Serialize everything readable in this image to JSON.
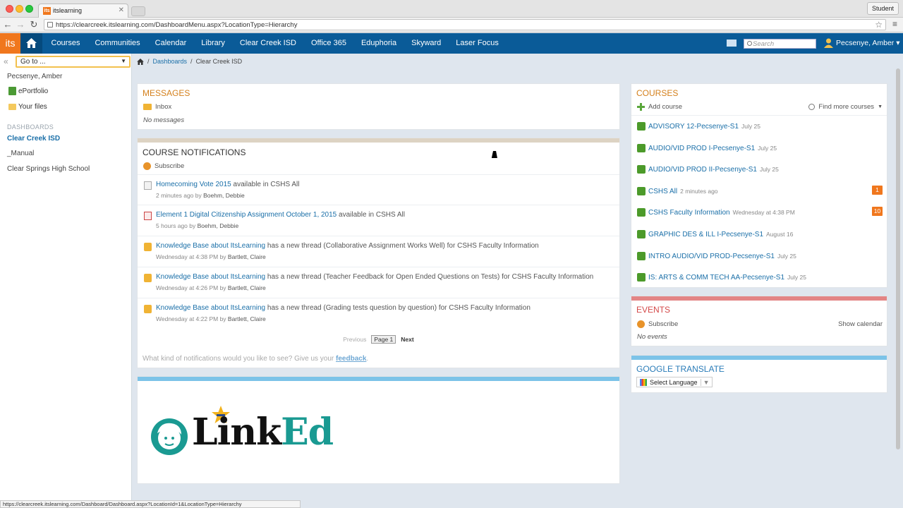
{
  "browser": {
    "tab_title": "itslearning",
    "tab_favicon": "its",
    "profile": "Student",
    "url": "https://clearcreek.itslearning.com/DashboardMenu.aspx?LocationType=Hierarchy",
    "status_url": "https://clearcreek.itslearning.com/Dashboard/Dashboard.aspx?LocationId=1&LocationType=Hierarchy"
  },
  "topbar": {
    "logo": "its",
    "nav": [
      "Courses",
      "Communities",
      "Calendar",
      "Library",
      "Clear Creek ISD",
      "Office 365",
      "Eduphoria",
      "Skyward",
      "Laser Focus"
    ],
    "search_placeholder": "Search",
    "user": "Pecsenye, Amber",
    "accent": "#0a5b98"
  },
  "sidebar": {
    "goto": "Go to ...",
    "user": "Pecsenye, Amber",
    "links": [
      "ePortfolio",
      "Your files"
    ],
    "dashboards_heading": "DASHBOARDS",
    "active": "Clear Creek ISD",
    "items": [
      "_Manual",
      "Clear Springs High School"
    ]
  },
  "breadcrumb": {
    "link": "Dashboards",
    "current": "Clear Creek ISD"
  },
  "messages": {
    "title": "MESSAGES",
    "inbox": "Inbox",
    "empty": "No messages"
  },
  "notifications": {
    "title": "COURSE NOTIFICATIONS",
    "subscribe": "Subscribe",
    "items": [
      {
        "link": "Homecoming Vote 2015",
        "text": " available in ",
        "place": "CSHS All",
        "time": "2 minutes ago",
        "by": " by ",
        "author": "Boehm, Debbie"
      },
      {
        "link": "Element 1 Digital Citizenship Assignment October 1, 2015",
        "text": " available in ",
        "place": "CSHS All",
        "time": "5 hours ago",
        "by": " by ",
        "author": "Boehm, Debbie"
      },
      {
        "link": "Knowledge Base about ItsLearning",
        "text": " has a new thread (Collaborative Assignment Works Well) for ",
        "place": "CSHS Faculty Information",
        "time": "Wednesday at 4:38 PM",
        "by": " by ",
        "author": "Bartlett, Claire"
      },
      {
        "link": "Knowledge Base about ItsLearning",
        "text": " has a new thread (Teacher Feedback for Open Ended Questions on Tests) for ",
        "place": "CSHS Faculty Information",
        "time": "Wednesday at 4:26 PM",
        "by": " by ",
        "author": "Bartlett, Claire"
      },
      {
        "link": "Knowledge Base about ItsLearning",
        "text": " has a new thread (Grading tests question by question) for ",
        "place": "CSHS Faculty Information",
        "time": "Wednesday at 4:22 PM",
        "by": " by ",
        "author": "Bartlett, Claire"
      }
    ],
    "pager": {
      "previous": "Previous",
      "current": "Page 1",
      "next": "Next"
    },
    "feedback_text": "What kind of notifications would you like to see? Give us your ",
    "feedback_link": "feedback",
    "feedback_end": "."
  },
  "linked": {
    "part1": "Link",
    "part2": "Ed"
  },
  "courses": {
    "title": "COURSES",
    "add": "Add course",
    "find": "Find more courses",
    "items": [
      {
        "name": "ADVISORY 12-Pecsenye-S1",
        "date": "July 25",
        "badge": ""
      },
      {
        "name": "AUDIO/VID PROD I-Pecsenye-S1",
        "date": "July 25",
        "badge": ""
      },
      {
        "name": "AUDIO/VID PROD II-Pecsenye-S1",
        "date": "July 25",
        "badge": ""
      },
      {
        "name": "CSHS All",
        "date": "2 minutes ago",
        "badge": "1"
      },
      {
        "name": "CSHS Faculty Information",
        "date": "Wednesday at 4:38 PM",
        "badge": "10"
      },
      {
        "name": "GRAPHIC DES & ILL I-Pecsenye-S1",
        "date": "August 16",
        "badge": ""
      },
      {
        "name": "INTRO AUDIO/VID PROD-Pecsenye-S1",
        "date": "July 25",
        "badge": ""
      },
      {
        "name": "IS: ARTS & COMM TECH AA-Pecsenye-S1",
        "date": "July 25",
        "badge": ""
      }
    ]
  },
  "events": {
    "title": "EVENTS",
    "subscribe": "Subscribe",
    "show_calendar": "Show calendar",
    "empty": "No events"
  },
  "translate": {
    "title": "GOOGLE TRANSLATE",
    "select": "Select Language"
  }
}
